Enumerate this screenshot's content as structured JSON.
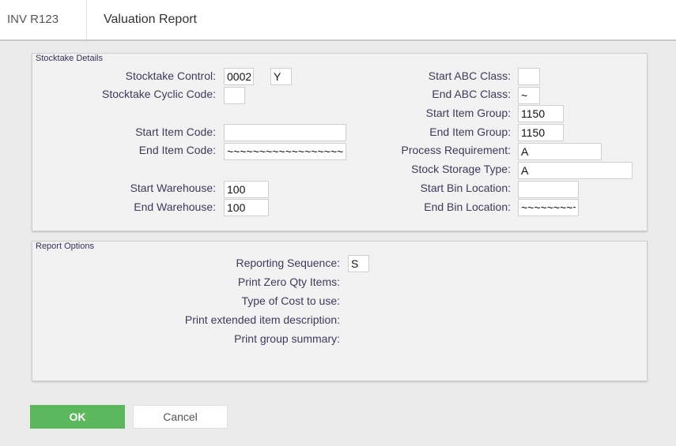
{
  "header": {
    "app_code": "INV R123",
    "title": "Valuation Report"
  },
  "stocktake": {
    "legend": "Stocktake Details",
    "control_label": "Stocktake Control:",
    "control_value": "0002",
    "control_flag": "Y",
    "cyclic_label": "Stocktake Cyclic Code:",
    "cyclic_value": "",
    "start_item_label": "Start Item Code:",
    "start_item_value": "",
    "end_item_label": "End Item Code:",
    "end_item_value": "~~~~~~~~~~~~~~~~~~",
    "start_wh_label": "Start Warehouse:",
    "start_wh_value": "100",
    "end_wh_label": "End Warehouse:",
    "end_wh_value": "100",
    "start_abc_label": "Start ABC Class:",
    "start_abc_value": "",
    "end_abc_label": "End ABC Class:",
    "end_abc_value": "~",
    "start_group_label": "Start Item Group:",
    "start_group_value": "1150",
    "end_group_label": "End Item Group:",
    "end_group_value": "1150",
    "process_req_label": "Process Requirement:",
    "process_req_value": "A",
    "storage_type_label": "Stock Storage Type:",
    "storage_type_value": "A",
    "start_bin_label": "Start Bin Location:",
    "start_bin_value": "",
    "end_bin_label": "End Bin Location:",
    "end_bin_value": "~~~~~~~~~~"
  },
  "options": {
    "legend": "Report Options",
    "sequence_label": "Reporting Sequence:",
    "sequence_value": "S",
    "zero_qty_label": "Print Zero Qty Items:",
    "cost_type_label": "Type of Cost to use:",
    "ext_desc_label": "Print extended item description:",
    "group_summary_label": "Print group summary:"
  },
  "buttons": {
    "ok": "OK",
    "cancel": "Cancel"
  },
  "colors": {
    "ok_button": "#5cb85c",
    "background": "#ebebeb",
    "panel": "#f2f2f2"
  }
}
